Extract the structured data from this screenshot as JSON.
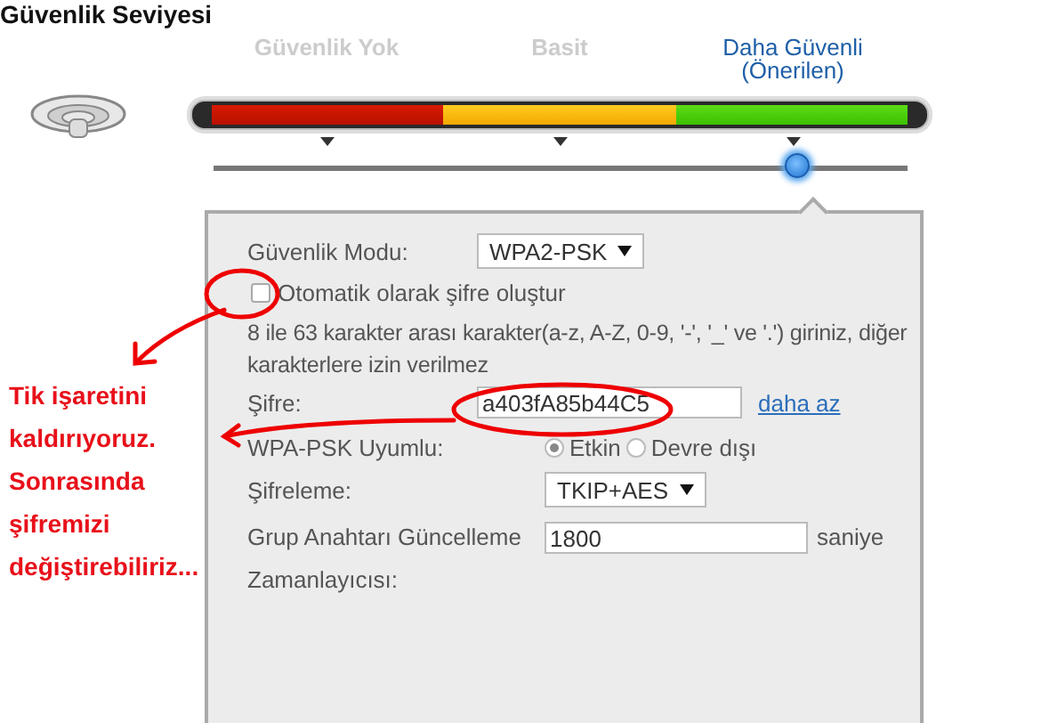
{
  "title": "Güvenlik Seviyesi",
  "security_levels": [
    {
      "label": "Güvenlik Yok",
      "selected": false
    },
    {
      "label": "Basit",
      "selected": false
    },
    {
      "label": "Daha Güvenli (Önerilen)",
      "selected": true
    }
  ],
  "slider": {
    "level": 0.84
  },
  "form": [
    {
      "kind": "select",
      "label": "Güvenlik Modu:",
      "value": "WPA2-PSK"
    },
    {
      "kind": "checkbox",
      "label": "Otomatik olarak şifre oluştur",
      "checked": false
    },
    {
      "kind": "note",
      "text": "8 ile 63 karakter arası karakter(a-z, A-Z, 0-9, '-', '_' ve '.') giriniz, diğer karakterlere izin verilmez"
    },
    {
      "kind": "input",
      "label": "Şifre:",
      "value": "a403fA85b44C5",
      "link": "daha az"
    },
    {
      "kind": "radio",
      "label": "WPA-PSK Uyumlu:",
      "options": [
        {
          "label": "Etkin",
          "selected": true
        },
        {
          "label": "Devre dışı",
          "selected": false
        }
      ]
    },
    {
      "kind": "select",
      "label": "Şifreleme:",
      "value": "TKIP+AES"
    },
    {
      "kind": "input",
      "label": "Grup Anahtarı Güncelleme Zamanlayıcısı:",
      "value": "1800",
      "unit": "saniye"
    }
  ],
  "annotation": {
    "text": "Tik işaretini kaldırıyoruz. Sonrasında şifremizi değiştirebiliriz..."
  }
}
